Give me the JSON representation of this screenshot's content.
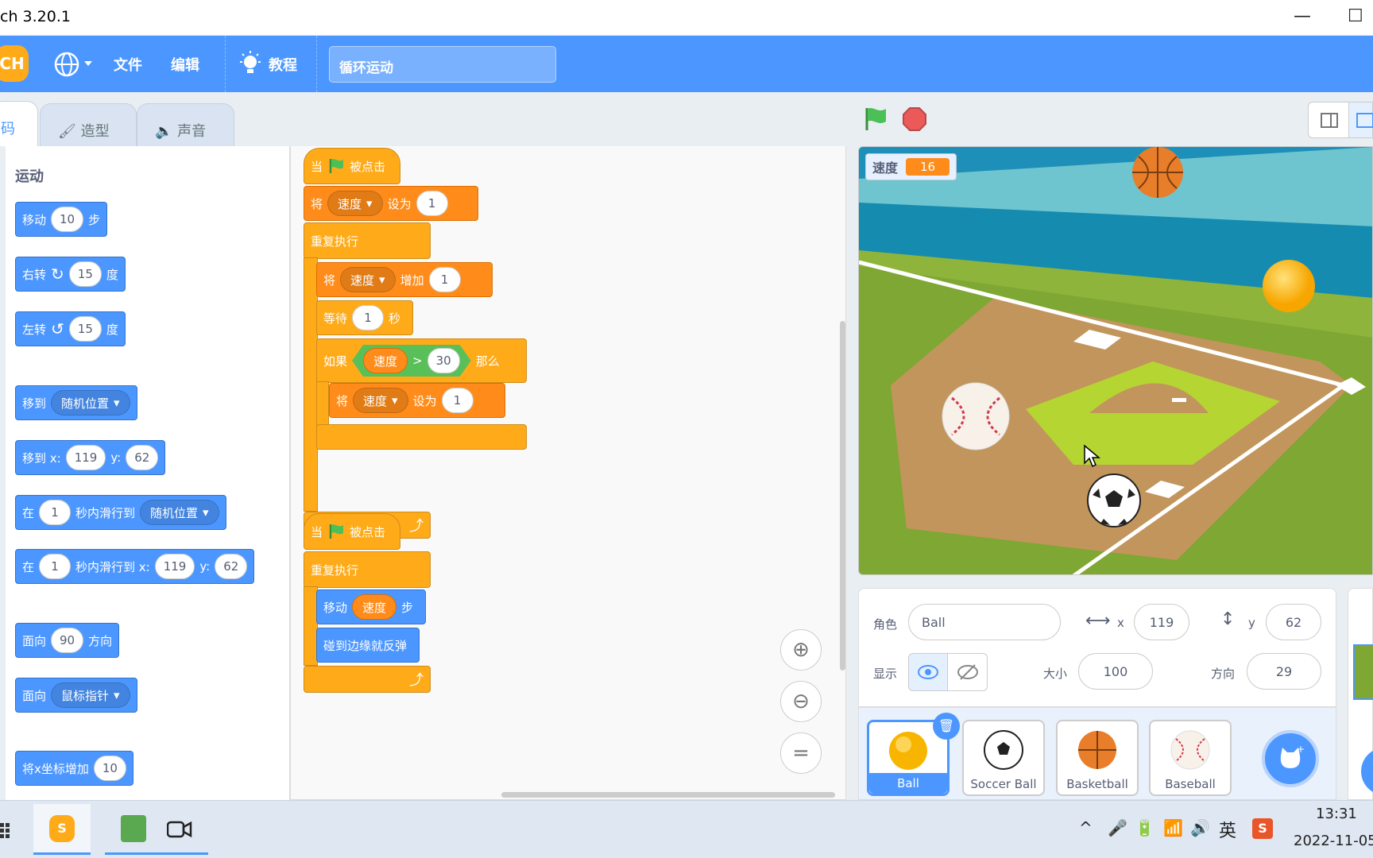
{
  "window": {
    "title": "ch 3.20.1",
    "minimize": "—",
    "maximize": "☐"
  },
  "menu": {
    "logo": "CH",
    "file": "文件",
    "edit": "编辑",
    "tutorials": "教程",
    "project_name": "循环运动"
  },
  "tabs": {
    "code": "码",
    "costumes": "造型",
    "sounds": "声音"
  },
  "palette": {
    "category": "运动",
    "move": {
      "label": "移动",
      "value": "10",
      "suffix": "步"
    },
    "turn_right": {
      "label": "右转",
      "value": "15",
      "suffix": "度"
    },
    "turn_left": {
      "label": "左转",
      "value": "15",
      "suffix": "度"
    },
    "goto_random": {
      "label": "移到",
      "option": "随机位置"
    },
    "goto_xy": {
      "label": "移到 x:",
      "x": "119",
      "ylabel": "y:",
      "y": "62"
    },
    "glide_random": {
      "label": "在",
      "secs": "1",
      "mid": "秒内滑行到",
      "option": "随机位置"
    },
    "glide_xy": {
      "label": "在",
      "secs": "1",
      "mid": "秒内滑行到 x:",
      "x": "119",
      "ylabel": "y:",
      "y": "62"
    },
    "point_dir": {
      "label": "面向",
      "value": "90",
      "suffix": "方向"
    },
    "point_towards": {
      "label": "面向",
      "option": "鼠标指针"
    },
    "change_x": {
      "label": "将x坐标增加",
      "value": "10"
    }
  },
  "script1": {
    "hat_pre": "当",
    "hat_post": "被点击",
    "set1": {
      "label": "将",
      "var": "速度",
      "mid": "设为",
      "value": "1"
    },
    "forever": "重复执行",
    "change": {
      "label": "将",
      "var": "速度",
      "mid": "增加",
      "value": "1"
    },
    "wait": {
      "label": "等待",
      "value": "1",
      "suffix": "秒"
    },
    "if": {
      "label": "如果",
      "var": "速度",
      "op": ">",
      "value": "30",
      "then": "那么"
    },
    "set2": {
      "label": "将",
      "var": "速度",
      "mid": "设为",
      "value": "1"
    }
  },
  "script2": {
    "hat_pre": "当",
    "hat_post": "被点击",
    "forever": "重复执行",
    "move": {
      "label": "移动",
      "var": "速度",
      "suffix": "步"
    },
    "bounce": "碰到边缘就反弹"
  },
  "stage": {
    "var_monitor_label": "速度",
    "var_monitor_value": "16"
  },
  "sprite_info": {
    "sprite_label": "角色",
    "sprite_name": "Ball",
    "x_label": "x",
    "x": "119",
    "y_label": "y",
    "y": "62",
    "show_label": "显示",
    "size_label": "大小",
    "size": "100",
    "direction_label": "方向",
    "direction": "29"
  },
  "sprites": [
    {
      "name": "Ball"
    },
    {
      "name": "Soccer Ball"
    },
    {
      "name": "Basketball"
    },
    {
      "name": "Baseball"
    }
  ],
  "taskbar": {
    "ime": "英",
    "time": "13:31",
    "date": "2022-11-05"
  },
  "colors": {
    "menu_blue": "#4c97ff",
    "motion_blue": "#4c97ff",
    "variable_orange": "#ff8c1a",
    "event_yellow": "#ffab19",
    "operator_green": "#59c059"
  }
}
